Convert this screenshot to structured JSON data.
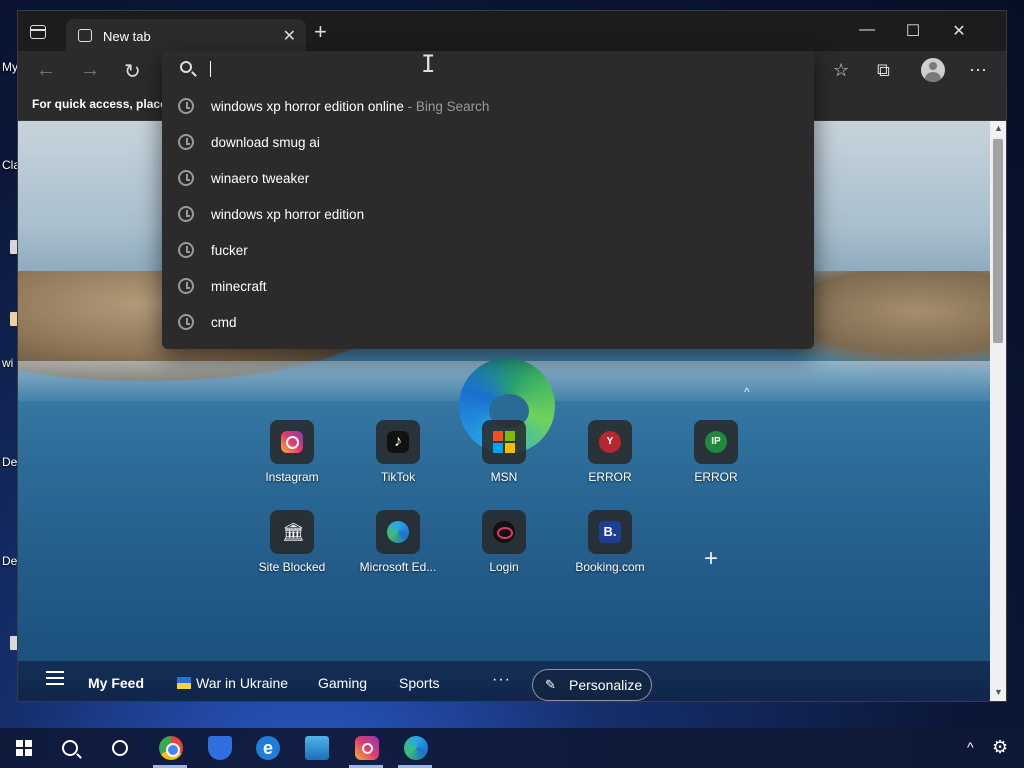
{
  "desktop": {
    "labels": [
      "My",
      "Cla",
      "wi",
      "De",
      "De"
    ]
  },
  "window": {
    "tab_title": "New tab",
    "tab_close": "✕",
    "new_tab": "+",
    "minimize": "—",
    "maximize": "☐",
    "close": "✕"
  },
  "toolbar": {
    "back": "←",
    "forward": "→",
    "refresh": "↻",
    "favorites": "☆",
    "collections": "⧉",
    "more": "⋯"
  },
  "favbar": {
    "message": "For quick access, place y"
  },
  "omnibox": {
    "value": "",
    "suggestions": [
      {
        "text": "windows xp horror edition online",
        "suffix": " - Bing Search"
      },
      {
        "text": "download smug ai",
        "suffix": ""
      },
      {
        "text": "winaero tweaker",
        "suffix": ""
      },
      {
        "text": "windows xp horror edition",
        "suffix": ""
      },
      {
        "text": "fucker",
        "suffix": ""
      },
      {
        "text": "minecraft",
        "suffix": ""
      },
      {
        "text": "cmd",
        "suffix": ""
      }
    ]
  },
  "newtab": {
    "collapse": "^",
    "add_site": "+",
    "quick_links": [
      {
        "label": "Instagram",
        "icon": "instagram-icon"
      },
      {
        "label": "TikTok",
        "icon": "tiktok-icon",
        "glyph": "♪"
      },
      {
        "label": "MSN",
        "icon": "msn-icon"
      },
      {
        "label": "ERROR",
        "icon": "error-y-icon",
        "glyph": "Y"
      },
      {
        "label": "ERROR",
        "icon": "error-ip-icon",
        "glyph": "IP"
      },
      {
        "label": "Site Blocked",
        "icon": "site-blocked-icon",
        "glyph": "🏛"
      },
      {
        "label": "Microsoft Ed...",
        "icon": "edge-icon"
      },
      {
        "label": "Login",
        "icon": "login-icon"
      },
      {
        "label": "Booking.com",
        "icon": "booking-icon",
        "glyph": "B."
      }
    ]
  },
  "feed": {
    "my_feed": "My Feed",
    "ukraine": "War in Ukraine",
    "gaming": "Gaming",
    "sports": "Sports",
    "more": "···",
    "personalize": "Personalize",
    "pencil": "✎"
  },
  "scroll": {
    "up": "▲",
    "down": "▼"
  },
  "taskbar": {
    "tray_arrow": "^",
    "settings": "⚙"
  }
}
